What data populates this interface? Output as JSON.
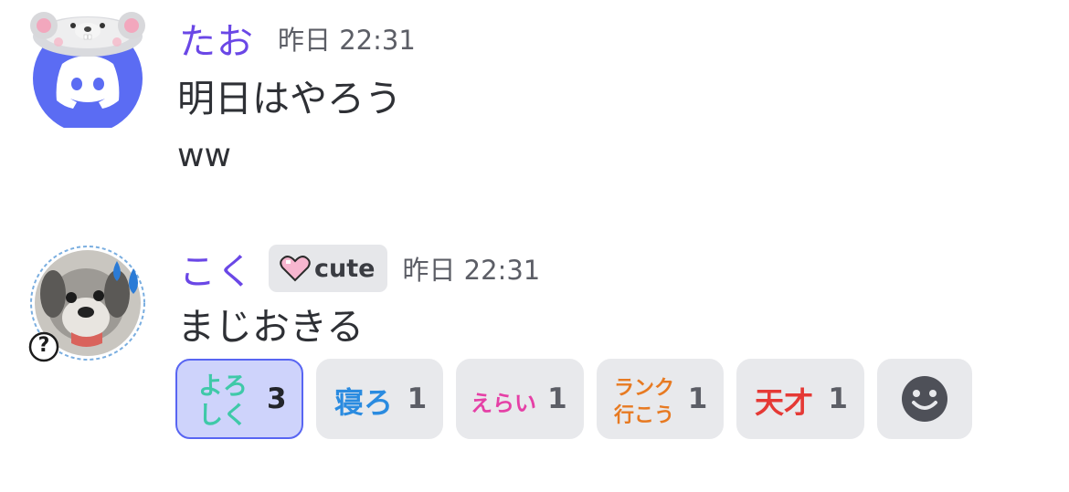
{
  "messages": [
    {
      "username": "たお",
      "timestamp": "昨日 22:31",
      "lines": [
        "明日はやろう",
        "ww"
      ],
      "avatar": {
        "type": "discord-logo-with-bear-hat",
        "bg_color": "#5865f2"
      }
    },
    {
      "username": "こく",
      "tag": {
        "icon": "pink-heart-icon",
        "label": "cute"
      },
      "timestamp": "昨日 22:31",
      "lines": [
        "まじおきる"
      ],
      "avatar": {
        "type": "dog-photo",
        "decoration": "sweat-drops",
        "badge": "?"
      },
      "reactions": [
        {
          "emoji_text": "よろしく",
          "count": "3",
          "selected": true,
          "color": "#3fc9a8"
        },
        {
          "emoji_text": "寝ろ",
          "count": "1",
          "selected": false,
          "color": "#2a8be0"
        },
        {
          "emoji_text": "えらい",
          "count": "1",
          "selected": false,
          "color": "#e540a6"
        },
        {
          "emoji_text": "ランク行こう",
          "count": "1",
          "selected": false,
          "color": "#e77a22"
        },
        {
          "emoji_text": "天才",
          "count": "1",
          "selected": false,
          "color": "#e53935"
        }
      ]
    }
  ],
  "add_reaction_icon": "smiley-face-icon"
}
